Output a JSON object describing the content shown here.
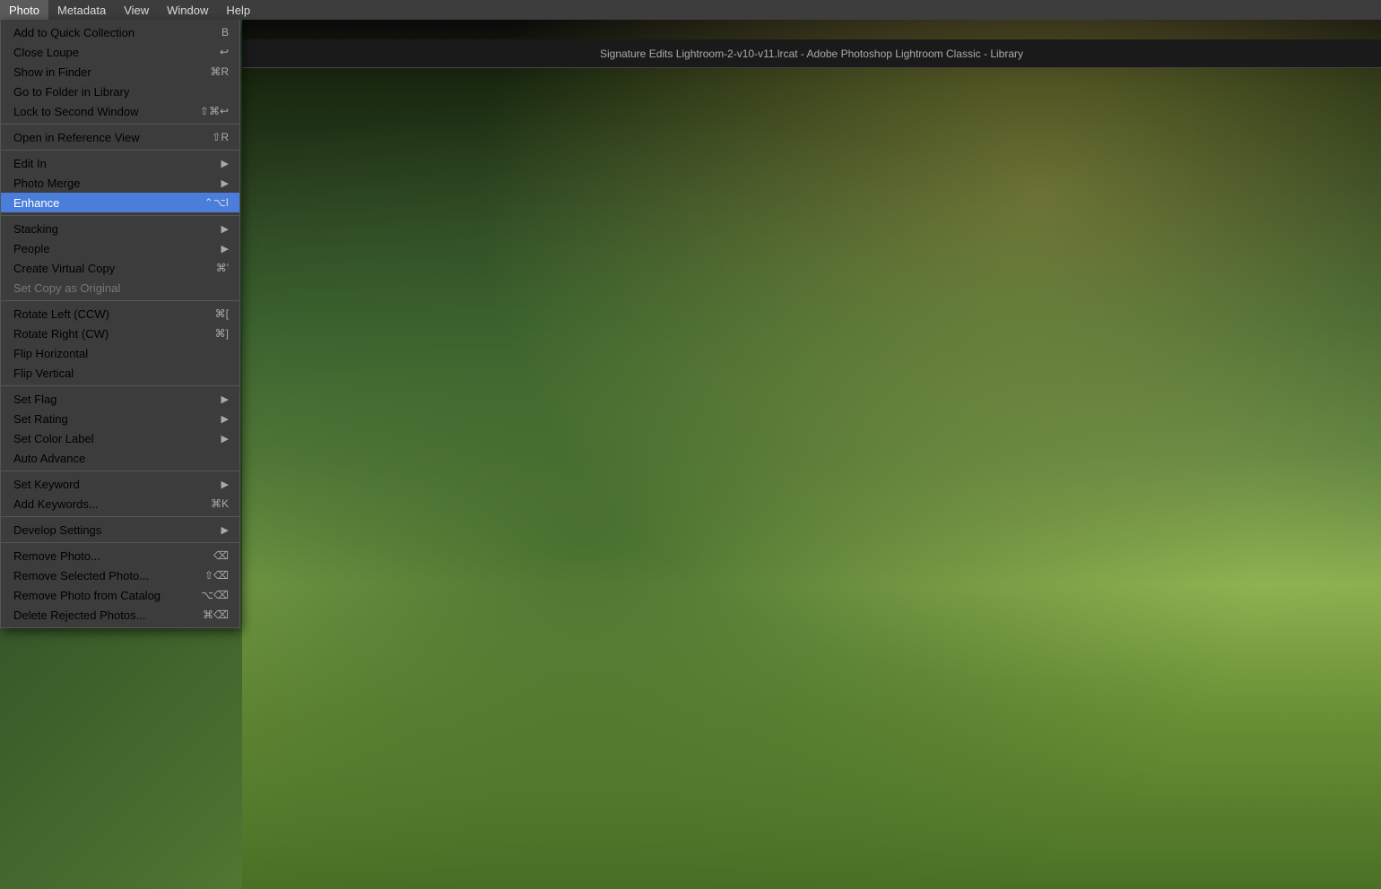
{
  "menubar": {
    "items": [
      {
        "id": "photo",
        "label": "Photo",
        "active": true
      },
      {
        "id": "metadata",
        "label": "Metadata"
      },
      {
        "id": "view",
        "label": "View"
      },
      {
        "id": "window",
        "label": "Window"
      },
      {
        "id": "help",
        "label": "Help"
      }
    ]
  },
  "titlebar": {
    "text": "Signature Edits Lightroom-2-v10-v11.lrcat - Adobe Photoshop Lightroom Classic - Library"
  },
  "dropdown": {
    "items": [
      {
        "id": "add-quick-collection",
        "label": "Add to Quick Collection",
        "shortcut": "B",
        "shortcut_symbol": "B",
        "has_arrow": false,
        "disabled": false,
        "highlighted": false,
        "separator_after": false
      },
      {
        "id": "close-loupe",
        "label": "Close Loupe",
        "shortcut": "↩",
        "shortcut_symbol": "↩",
        "has_arrow": false,
        "disabled": false,
        "highlighted": false,
        "separator_after": false
      },
      {
        "id": "show-in-finder",
        "label": "Show in Finder",
        "shortcut": "⌘ R",
        "shortcut_symbol": "⌘R",
        "has_arrow": false,
        "disabled": false,
        "highlighted": false,
        "separator_after": false
      },
      {
        "id": "go-to-folder",
        "label": "Go to Folder in Library",
        "shortcut": "",
        "shortcut_symbol": "",
        "has_arrow": false,
        "disabled": false,
        "highlighted": false,
        "separator_after": false
      },
      {
        "id": "lock-second-window",
        "label": "Lock to Second Window",
        "shortcut": "⇧⌘↩",
        "shortcut_symbol": "⇧⌘↩",
        "has_arrow": false,
        "disabled": false,
        "highlighted": false,
        "separator_after": true
      },
      {
        "id": "open-reference-view",
        "label": "Open in Reference View",
        "shortcut": "⇧ R",
        "shortcut_symbol": "⇧R",
        "has_arrow": false,
        "disabled": false,
        "highlighted": false,
        "separator_after": true
      },
      {
        "id": "edit-in",
        "label": "Edit In",
        "shortcut": "",
        "shortcut_symbol": "",
        "has_arrow": true,
        "disabled": false,
        "highlighted": false,
        "separator_after": false
      },
      {
        "id": "photo-merge",
        "label": "Photo Merge",
        "shortcut": "",
        "shortcut_symbol": "",
        "has_arrow": true,
        "disabled": false,
        "highlighted": false,
        "separator_after": false
      },
      {
        "id": "enhance",
        "label": "Enhance",
        "shortcut": "⌃ ⌥ I",
        "shortcut_symbol": "⌃⌥I",
        "has_arrow": false,
        "disabled": false,
        "highlighted": true,
        "separator_after": true
      },
      {
        "id": "stacking",
        "label": "Stacking",
        "shortcut": "",
        "shortcut_symbol": "",
        "has_arrow": true,
        "disabled": false,
        "highlighted": false,
        "separator_after": false
      },
      {
        "id": "people",
        "label": "People",
        "shortcut": "",
        "shortcut_symbol": "",
        "has_arrow": true,
        "disabled": false,
        "highlighted": false,
        "separator_after": false
      },
      {
        "id": "create-virtual-copy",
        "label": "Create Virtual Copy",
        "shortcut": "⌘ '",
        "shortcut_symbol": "⌘'",
        "has_arrow": false,
        "disabled": false,
        "highlighted": false,
        "separator_after": false
      },
      {
        "id": "set-copy-as-original",
        "label": "Set Copy as Original",
        "shortcut": "",
        "shortcut_symbol": "",
        "has_arrow": false,
        "disabled": true,
        "highlighted": false,
        "separator_after": true
      },
      {
        "id": "rotate-left",
        "label": "Rotate Left (CCW)",
        "shortcut": "⌘ [",
        "shortcut_symbol": "⌘[",
        "has_arrow": false,
        "disabled": false,
        "highlighted": false,
        "separator_after": false
      },
      {
        "id": "rotate-right",
        "label": "Rotate Right (CW)",
        "shortcut": "⌘ ]",
        "shortcut_symbol": "⌘]",
        "has_arrow": false,
        "disabled": false,
        "highlighted": false,
        "separator_after": false
      },
      {
        "id": "flip-horizontal",
        "label": "Flip Horizontal",
        "shortcut": "",
        "shortcut_symbol": "",
        "has_arrow": false,
        "disabled": false,
        "highlighted": false,
        "separator_after": false
      },
      {
        "id": "flip-vertical",
        "label": "Flip Vertical",
        "shortcut": "",
        "shortcut_symbol": "",
        "has_arrow": false,
        "disabled": false,
        "highlighted": false,
        "separator_after": true
      },
      {
        "id": "set-flag",
        "label": "Set Flag",
        "shortcut": "",
        "shortcut_symbol": "",
        "has_arrow": true,
        "disabled": false,
        "highlighted": false,
        "separator_after": false
      },
      {
        "id": "set-rating",
        "label": "Set Rating",
        "shortcut": "",
        "shortcut_symbol": "",
        "has_arrow": true,
        "disabled": false,
        "highlighted": false,
        "separator_after": false
      },
      {
        "id": "set-color-label",
        "label": "Set Color Label",
        "shortcut": "",
        "shortcut_symbol": "",
        "has_arrow": true,
        "disabled": false,
        "highlighted": false,
        "separator_after": false
      },
      {
        "id": "auto-advance",
        "label": "Auto Advance",
        "shortcut": "",
        "shortcut_symbol": "",
        "has_arrow": false,
        "disabled": false,
        "highlighted": false,
        "separator_after": true
      },
      {
        "id": "set-keyword",
        "label": "Set Keyword",
        "shortcut": "",
        "shortcut_symbol": "",
        "has_arrow": true,
        "disabled": false,
        "highlighted": false,
        "separator_after": false
      },
      {
        "id": "add-keywords",
        "label": "Add Keywords...",
        "shortcut": "⌘ K",
        "shortcut_symbol": "⌘K",
        "has_arrow": false,
        "disabled": false,
        "highlighted": false,
        "separator_after": true
      },
      {
        "id": "develop-settings",
        "label": "Develop Settings",
        "shortcut": "",
        "shortcut_symbol": "",
        "has_arrow": true,
        "disabled": false,
        "highlighted": false,
        "separator_after": true
      },
      {
        "id": "remove-photo",
        "label": "Remove Photo...",
        "shortcut": "⌫",
        "shortcut_symbol": "⌫",
        "has_arrow": false,
        "disabled": false,
        "highlighted": false,
        "separator_after": false
      },
      {
        "id": "remove-selected-photo",
        "label": "Remove Selected Photo...",
        "shortcut": "⇧⌫",
        "shortcut_symbol": "⇧⌫",
        "has_arrow": false,
        "disabled": false,
        "highlighted": false,
        "separator_after": false
      },
      {
        "id": "remove-photo-from-catalog",
        "label": "Remove Photo from Catalog",
        "shortcut": "⌥⌫",
        "shortcut_symbol": "⌥⌫",
        "has_arrow": false,
        "disabled": false,
        "highlighted": false,
        "separator_after": false
      },
      {
        "id": "delete-rejected",
        "label": "Delete Rejected Photos...",
        "shortcut": "⌘⌫",
        "shortcut_symbol": "⌘⌫",
        "has_arrow": false,
        "disabled": false,
        "highlighted": false,
        "separator_after": false
      }
    ]
  }
}
